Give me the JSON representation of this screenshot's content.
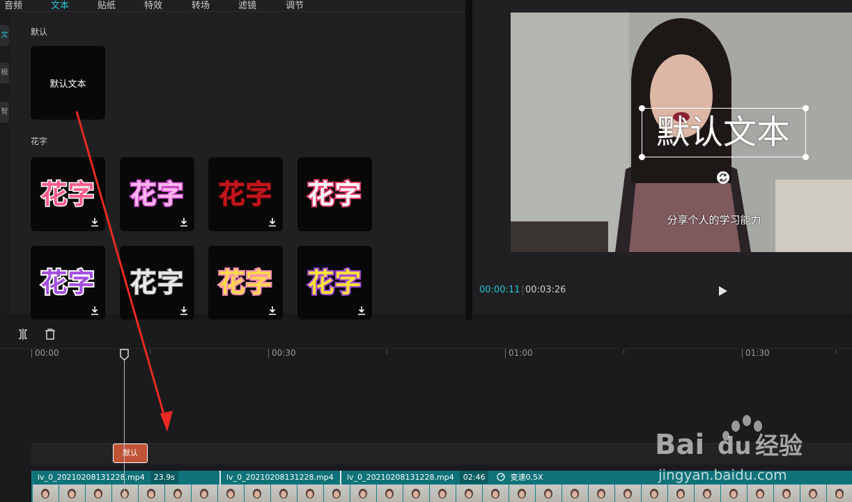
{
  "library": {
    "tabs": [
      "音频",
      "文本",
      "贴纸",
      "特效",
      "转场",
      "滤镜",
      "调节"
    ],
    "active_tab": "文本",
    "side_items": [
      "文",
      "模",
      "智"
    ],
    "sections": {
      "default_label": "默认",
      "flower_label": "花字"
    },
    "default_tile_text": "默认文本",
    "flower_tile_text": "花字"
  },
  "preview": {
    "overlay_text": "默认文本",
    "subtitle": "分享个人的学习能力",
    "time_current": "00:00:11",
    "time_separator": "|",
    "time_total": "00:03:26"
  },
  "timeline": {
    "ruler": [
      "00:00",
      "00:30",
      "01:00",
      "01:30"
    ],
    "text_clip_label": "默认",
    "clips": [
      {
        "name": "lv_0_20210208131228.mp4",
        "duration": "23.9s"
      },
      {
        "name": "lv_0_20210208131228.mp4"
      },
      {
        "name": "lv_0_20210208131228.mp4",
        "duration": "02:46",
        "speed": "变速0.5X"
      }
    ],
    "playhead_position": 0.058
  },
  "watermark": {
    "logo_text": "Bai",
    "logo_text2": "du",
    "logo_cn": "经验",
    "url": "jingyan.baidu.com"
  },
  "colors": {
    "accent": "#26c6d6",
    "text_clip": "#c05236",
    "video_track": "#177d86",
    "annotation_arrow": "#ea2a22"
  },
  "icons": [
    "download-icon",
    "split-icon",
    "delete-icon",
    "play-icon",
    "rotate-icon",
    "playhead-icon"
  ]
}
